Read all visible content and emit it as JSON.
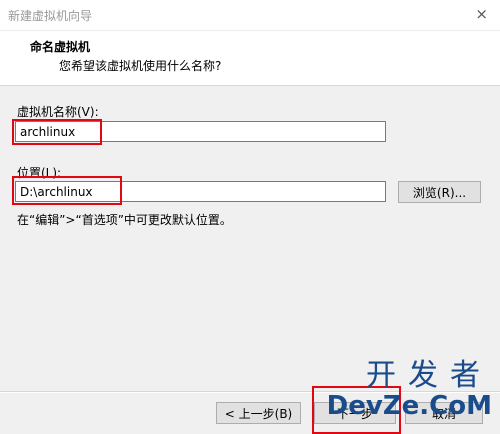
{
  "window": {
    "title": "新建虚拟机向导",
    "close_glyph": "×"
  },
  "header": {
    "title": "命名虚拟机",
    "subtitle": "您希望该虚拟机使用什么名称?"
  },
  "form": {
    "name_label": "虚拟机名称(V):",
    "name_value": "archlinux",
    "location_label": "位置(L):",
    "location_value": "D:\\archlinux",
    "browse_label": "浏览(R)...",
    "hint": "在“编辑”>“首选项”中可更改默认位置。"
  },
  "footer": {
    "back_label": "< 上一步(B)",
    "next_label": "下一步",
    "cancel_label": "取消"
  },
  "watermark": {
    "line1": "开发者",
    "line2": "DevZe.CoM"
  },
  "colors": {
    "highlight": "#e30613",
    "watermark": "#1a4c8c"
  }
}
